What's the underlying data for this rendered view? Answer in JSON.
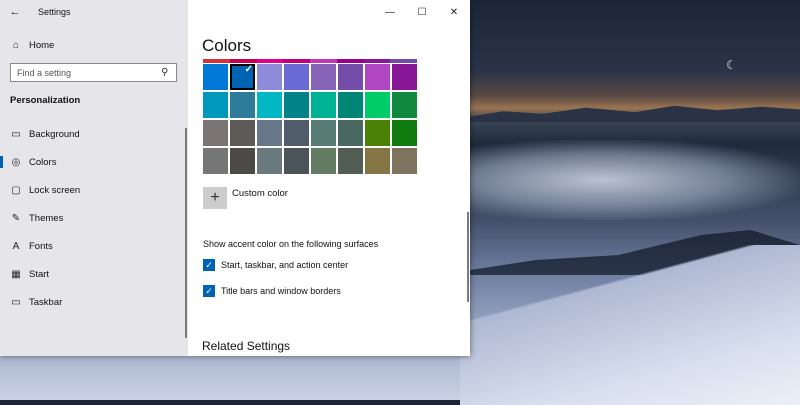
{
  "window": {
    "title": "Settings",
    "back_icon": "arrow-left-icon",
    "controls": {
      "minimize": "—",
      "maximize": "☐",
      "close": "✕"
    }
  },
  "sidebar": {
    "home_label": "Home",
    "search_placeholder": "Find a setting",
    "section_label": "Personalization",
    "items": [
      {
        "label": "Background",
        "icon": "picture-icon",
        "glyph": "▭"
      },
      {
        "label": "Colors",
        "icon": "palette-icon",
        "glyph": "◎",
        "selected": true
      },
      {
        "label": "Lock screen",
        "icon": "lock-screen-icon",
        "glyph": "▢"
      },
      {
        "label": "Themes",
        "icon": "themes-icon",
        "glyph": "✎"
      },
      {
        "label": "Fonts",
        "icon": "fonts-icon",
        "glyph": "A"
      },
      {
        "label": "Start",
        "icon": "start-icon",
        "glyph": "▦"
      },
      {
        "label": "Taskbar",
        "icon": "taskbar-icon",
        "glyph": "▭"
      }
    ]
  },
  "content": {
    "title": "Colors",
    "top_row_colors": [
      "#d13438",
      "#c30052",
      "#e3008c",
      "#bf0077",
      "#c239b3",
      "#9a0089",
      "#881798",
      "#744da9"
    ],
    "swatch_rows": [
      [
        "#0078d7",
        "#0063b1",
        "#8e8cd8",
        "#6b69d6",
        "#8764b8",
        "#744da9",
        "#b146c2",
        "#881798"
      ],
      [
        "#0099bc",
        "#2d7d9a",
        "#00b7c3",
        "#038387",
        "#00b294",
        "#018574",
        "#00cc6a",
        "#10893e"
      ],
      [
        "#7a7574",
        "#5d5a58",
        "#68768a",
        "#515c6b",
        "#567c73",
        "#486860",
        "#498205",
        "#107c10"
      ],
      [
        "#767676",
        "#4c4a48",
        "#69797e",
        "#4a5459",
        "#647c64",
        "#525e54",
        "#847545",
        "#7e735f"
      ]
    ],
    "selected_swatch": {
      "row": 0,
      "col": 1
    },
    "checkmark": "✓",
    "custom_color_label": "Custom color",
    "custom_color_icon": "+",
    "show_accent_label": "Show accent color on the following surfaces",
    "checkboxes": [
      {
        "label": "Start, taskbar, and action center",
        "checked": true
      },
      {
        "label": "Title bars and window borders",
        "checked": true
      }
    ],
    "related_settings_label": "Related Settings"
  }
}
